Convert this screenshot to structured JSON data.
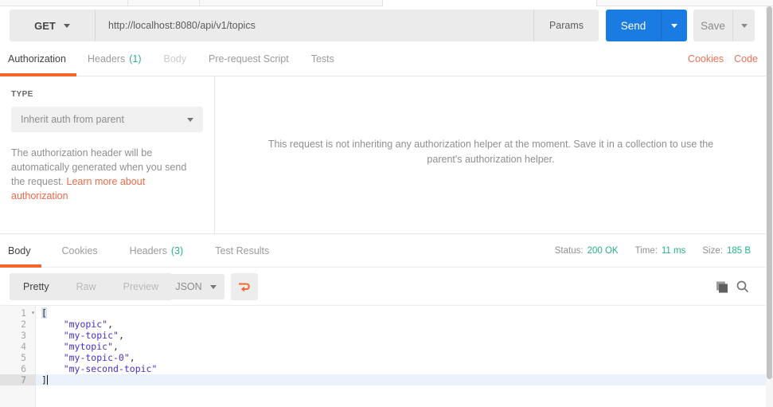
{
  "colors": {
    "accent_orange": "#f4662c",
    "link_orange": "#ef7153",
    "status_green": "#26b28b",
    "send_blue": "#1a7ce2",
    "string_blue": "#4331c8"
  },
  "request": {
    "method": "GET",
    "url": "http://localhost:8080/api/v1/topics",
    "params_label": "Params",
    "send_label": "Send",
    "save_label": "Save"
  },
  "request_tabs": {
    "items": [
      {
        "label": "Authorization",
        "count": ""
      },
      {
        "label": "Headers",
        "count": "(1)"
      },
      {
        "label": "Body",
        "count": ""
      },
      {
        "label": "Pre-request Script",
        "count": ""
      },
      {
        "label": "Tests",
        "count": ""
      }
    ],
    "cookies_link": "Cookies",
    "code_link": "Code"
  },
  "auth": {
    "type_label": "TYPE",
    "type_value": "Inherit auth from parent",
    "description": "The authorization header will be automatically generated when you send the request. ",
    "link_text": "Learn more about authorization",
    "helper_message": "This request is not inheriting any authorization helper at the moment. Save it in a collection to use the parent's authorization helper."
  },
  "response": {
    "tabs": [
      {
        "label": "Body",
        "count": ""
      },
      {
        "label": "Cookies",
        "count": ""
      },
      {
        "label": "Headers",
        "count": "(3)"
      },
      {
        "label": "Test Results",
        "count": ""
      }
    ],
    "meta": {
      "status_label": "Status:",
      "status_value": "200 OK",
      "time_label": "Time:",
      "time_value": "11 ms",
      "size_label": "Size:",
      "size_value": "185 B"
    },
    "toolbar": {
      "views": [
        "Pretty",
        "Raw",
        "Preview"
      ],
      "language": "JSON"
    }
  },
  "editor": {
    "lines": [
      {
        "num": "1",
        "text": "["
      },
      {
        "num": "2",
        "text": "    \"myopic\"",
        "suffix": ","
      },
      {
        "num": "3",
        "text": "    \"my-topic\"",
        "suffix": ","
      },
      {
        "num": "4",
        "text": "    \"mytopic\"",
        "suffix": ","
      },
      {
        "num": "5",
        "text": "    \"my-topic-0\"",
        "suffix": ","
      },
      {
        "num": "6",
        "text": "    \"my-second-topic\"",
        "suffix": ""
      },
      {
        "num": "7",
        "text": "]"
      }
    ]
  },
  "icons": {
    "wrap": "wrap-text-icon",
    "copy": "copy-icon",
    "search": "search-icon",
    "chevron": "chevron-down-icon",
    "fold": "fold-arrow-icon"
  }
}
